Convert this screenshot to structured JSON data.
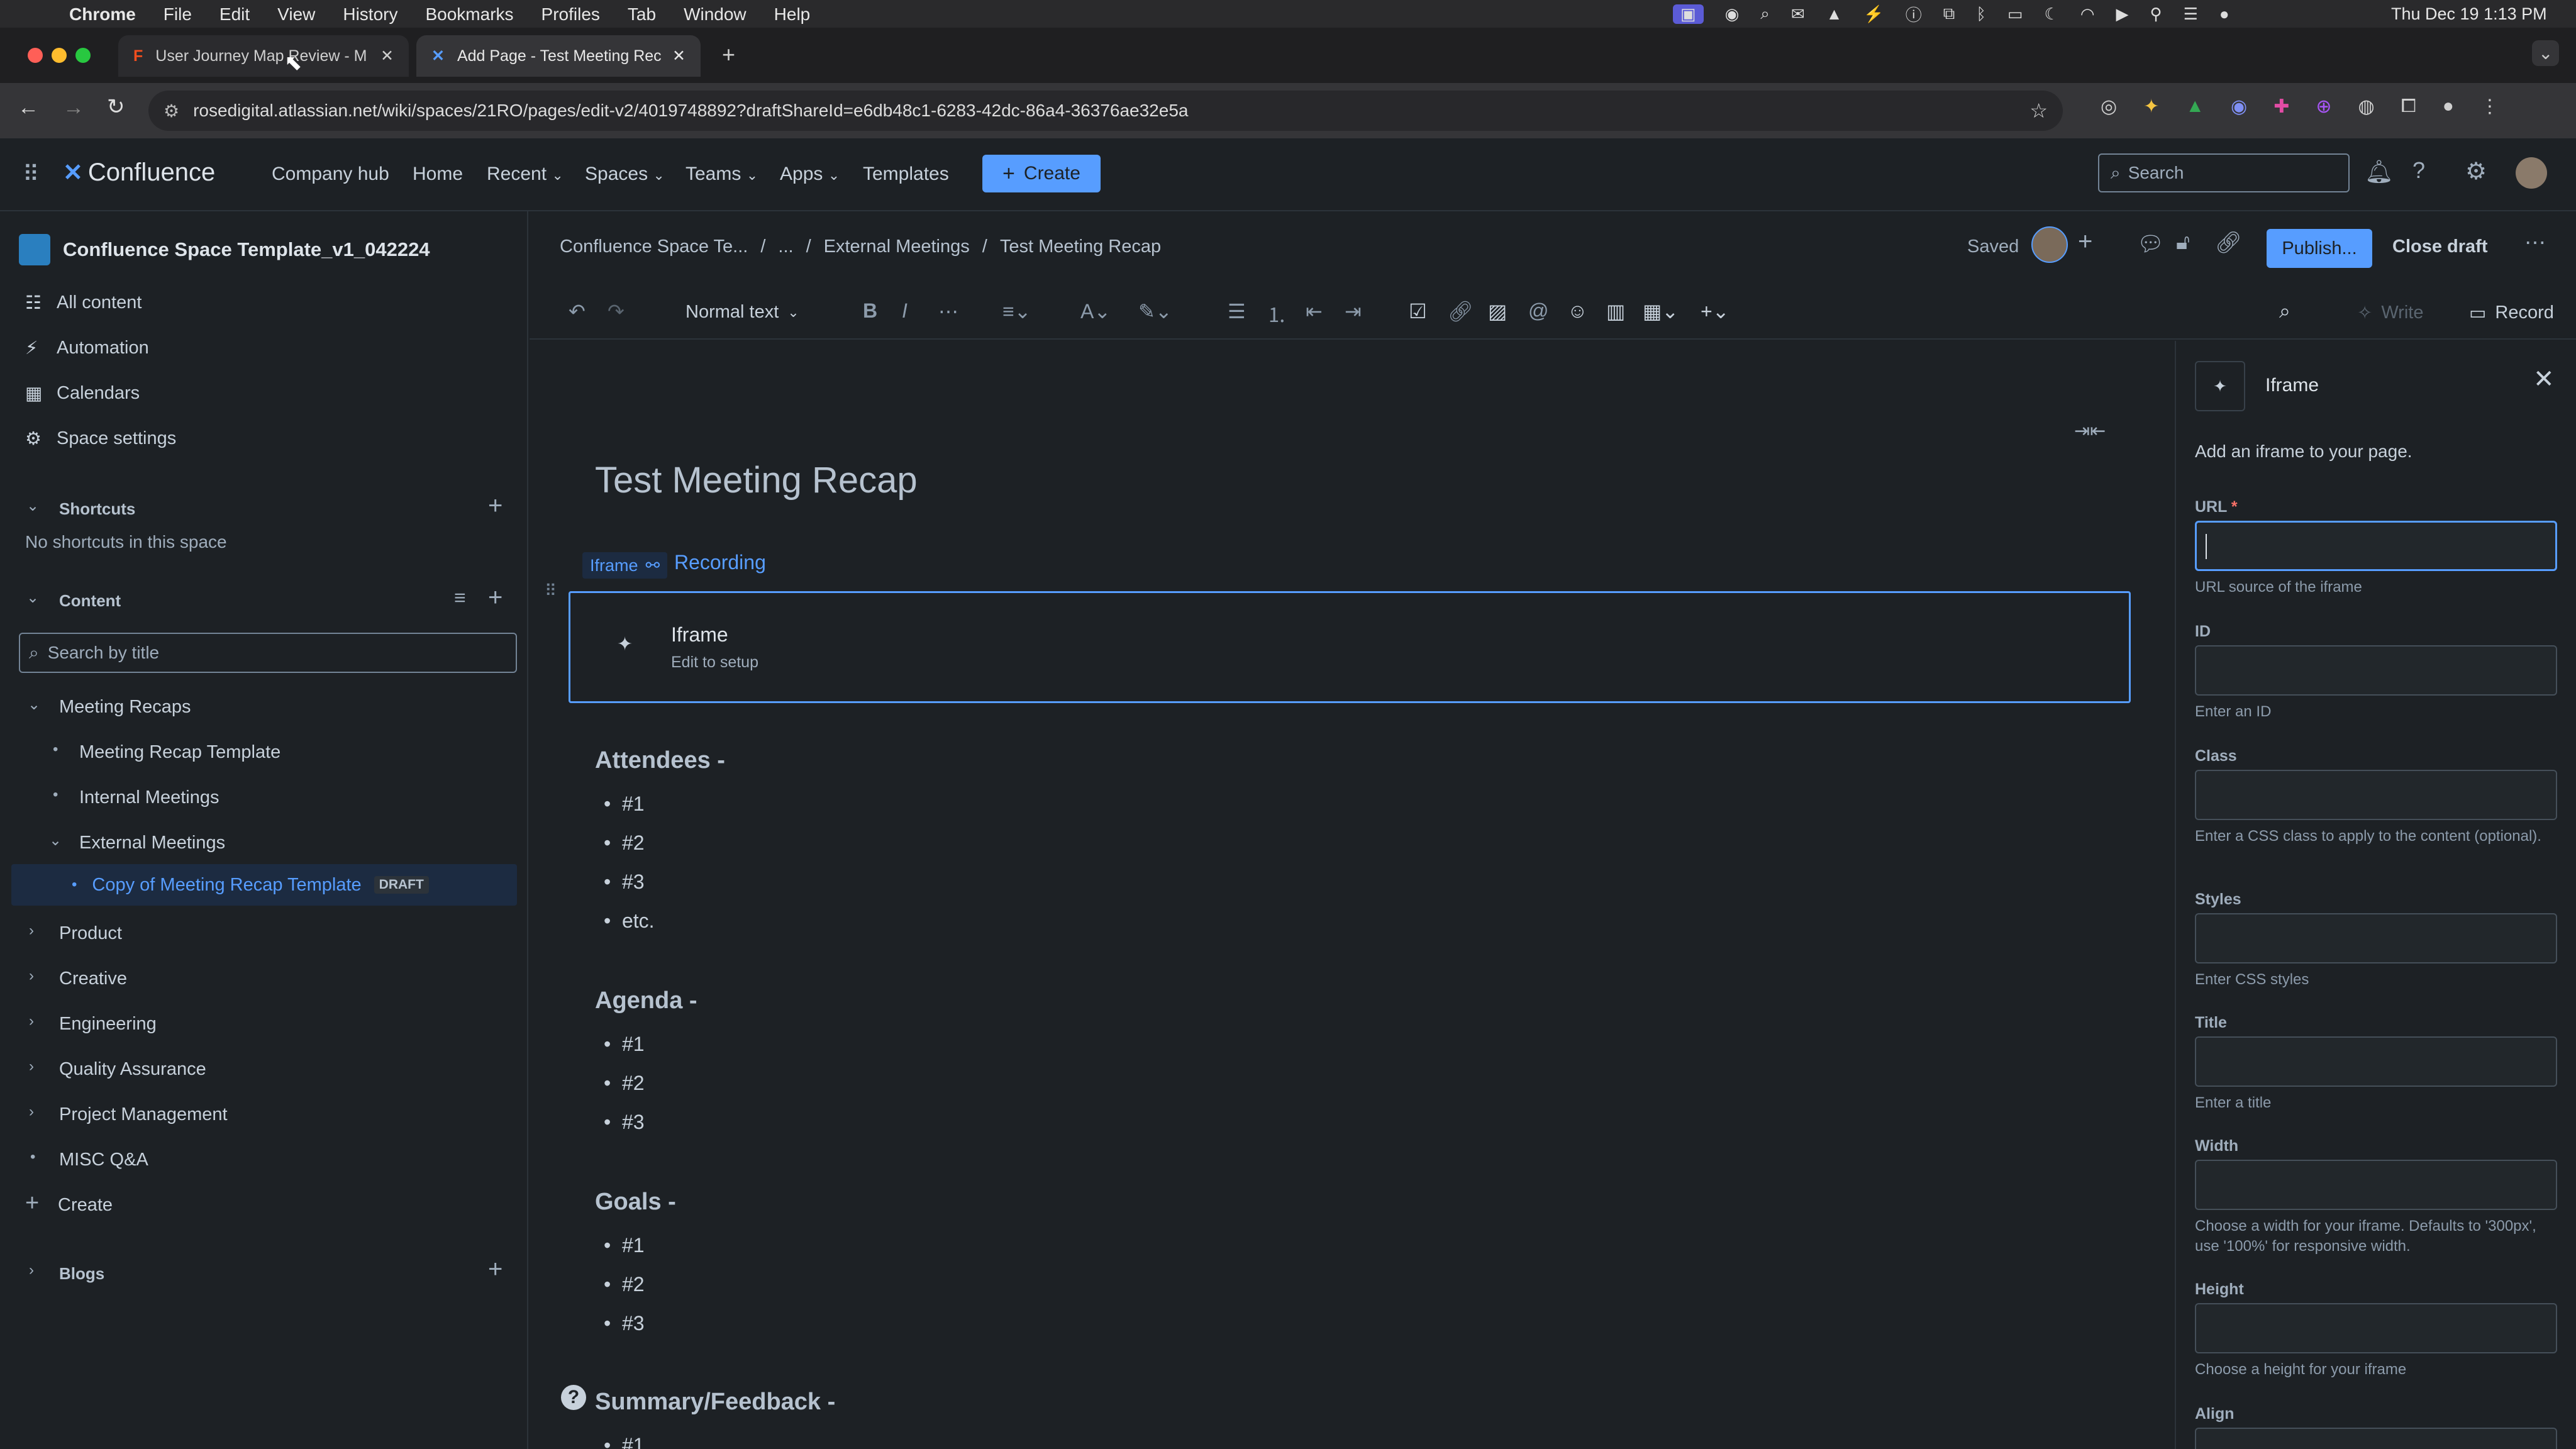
{
  "menubar": {
    "app": "Chrome",
    "items": [
      "File",
      "Edit",
      "View",
      "History",
      "Bookmarks",
      "Profiles",
      "Tab",
      "Window",
      "Help"
    ],
    "clock": "Thu Dec 19  1:13 PM"
  },
  "tabs": [
    {
      "title": "User Journey Map Review - M"
    },
    {
      "title": "Add Page - Test Meeting Rec"
    }
  ],
  "url": "rosedigital.atlassian.net/wiki/spaces/21RO/pages/edit-v2/4019748892?draftShareId=e6db48c1-6283-42dc-86a4-36376ae32e5a",
  "nav": {
    "brand": "Confluence",
    "links": [
      "Company hub",
      "Home",
      "Recent",
      "Spaces",
      "Teams",
      "Apps",
      "Templates"
    ],
    "create": "Create",
    "search_placeholder": "Search"
  },
  "sidebar": {
    "space_name": "Confluence Space Template_v1_042224",
    "items": [
      "All content",
      "Automation",
      "Calendars",
      "Space settings"
    ],
    "shortcuts_title": "Shortcuts",
    "shortcuts_empty": "No shortcuts in this space",
    "content_title": "Content",
    "search_placeholder": "Search by title",
    "tree": {
      "meeting_recaps": "Meeting Recaps",
      "template": "Meeting Recap Template",
      "internal": "Internal Meetings",
      "external": "External Meetings",
      "copy": "Copy of Meeting Recap Template",
      "draft_badge": "DRAFT",
      "others": [
        "Product",
        "Creative",
        "Engineering",
        "Quality Assurance",
        "Project Management",
        "MISC Q&A"
      ]
    },
    "create": "Create",
    "blogs": "Blogs"
  },
  "editor": {
    "breadcrumb": [
      "Confluence Space Te...",
      "...",
      "External Meetings",
      "Test Meeting Recap"
    ],
    "saved": "Saved",
    "publish": "Publish...",
    "close_draft": "Close draft",
    "text_style": "Normal text",
    "write": "Write",
    "record": "Record"
  },
  "page": {
    "title": "Test Meeting Recap",
    "iframe_tag": "Iframe",
    "recording_link": "Recording",
    "iframe_title": "Iframe",
    "iframe_sub": "Edit to setup",
    "attendees": "Attendees -",
    "attendee_items": [
      "#1",
      "#2",
      "#3",
      "etc."
    ],
    "agenda": "Agenda -",
    "agenda_items": [
      "#1",
      "#2",
      "#3"
    ],
    "goals": "Goals -",
    "goal_items": [
      "#1",
      "#2",
      "#3"
    ],
    "summary": "Summary/Feedback -",
    "summary_first": "#1"
  },
  "panel": {
    "title": "Iframe",
    "description": "Add an iframe to your page.",
    "url_label": "URL",
    "url_help": "URL source of the iframe",
    "id_label": "ID",
    "id_help": "Enter an ID",
    "class_label": "Class",
    "class_help": "Enter a CSS class to apply to the content (optional).",
    "styles_label": "Styles",
    "styles_help": "Enter CSS styles",
    "title_label": "Title",
    "title_help": "Enter a title",
    "width_label": "Width",
    "width_help": "Choose a width for your iframe. Defaults to '300px', use '100%' for responsive width.",
    "height_label": "Height",
    "height_help": "Choose a height for your iframe",
    "align_label": "Align"
  },
  "colors": {
    "accent": "#579dff",
    "publish": "#579dff",
    "bg": "#1d2125"
  }
}
